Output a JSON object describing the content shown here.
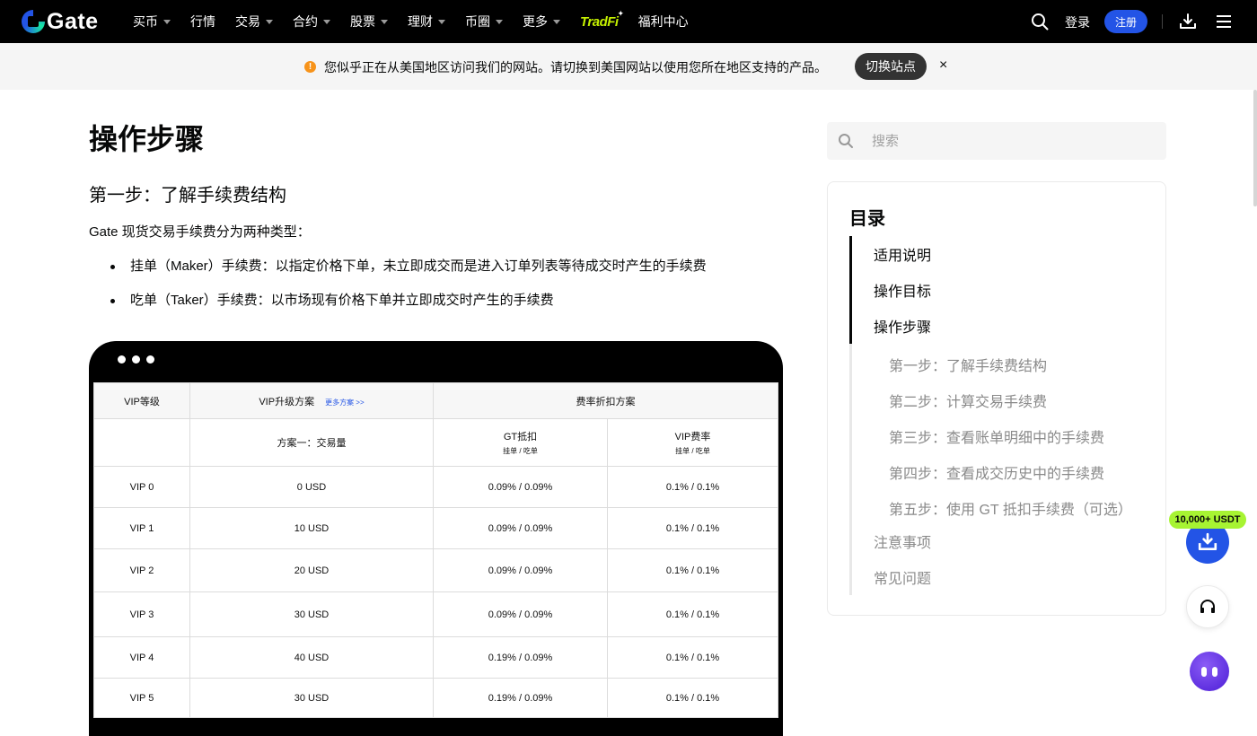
{
  "nav": {
    "logo_text": "Gate",
    "items": [
      {
        "label": "买币",
        "caret": true
      },
      {
        "label": "行情",
        "caret": false
      },
      {
        "label": "交易",
        "caret": true
      },
      {
        "label": "合约",
        "caret": true
      },
      {
        "label": "股票",
        "caret": true
      },
      {
        "label": "理财",
        "caret": true
      },
      {
        "label": "币圈",
        "caret": true
      },
      {
        "label": "更多",
        "caret": true
      }
    ],
    "tradfi": "TradFi",
    "welfare": "福利中心",
    "login": "登录",
    "register": "注册"
  },
  "notice": {
    "text": "您似乎正在从美国地区访问我们的网站。请切换到美国网站以使用您所在地区支持的产品。",
    "switch_label": "切换站点",
    "close": "×"
  },
  "article": {
    "h1": "操作步骤",
    "h2": "第一步：了解手续费结构",
    "intro": "Gate 现货交易手续费分为两种类型：",
    "bullets": [
      "挂单（Maker）手续费：以指定价格下单，未立即成交而是进入订单列表等待成交时产生的手续费",
      "吃单（Taker）手续费：以市场现有价格下单并立即成交时产生的手续费"
    ]
  },
  "fee_table": {
    "col_vip": "VIP等级",
    "col_upgrade": "VIP升级方案",
    "more_plans": "更多方案 >>",
    "col_discount": "费率折扣方案",
    "plan1": "方案一：交易量",
    "gt_deduct": "GT抵扣",
    "vip_rate": "VIP费率",
    "maker_taker": "挂单 / 吃单",
    "rows": [
      {
        "level": "VIP 0",
        "volume": "0 USD",
        "gt": "0.09% / 0.09%",
        "vip": "0.1% / 0.1%"
      },
      {
        "level": "VIP 1",
        "volume": "10 USD",
        "gt": "0.09% / 0.09%",
        "vip": "0.1% / 0.1%"
      },
      {
        "level": "VIP 2",
        "volume": "20 USD",
        "gt": "0.09% / 0.09%",
        "vip": "0.1% / 0.1%"
      },
      {
        "level": "VIP 3",
        "volume": "30 USD",
        "gt": "0.09% / 0.09%",
        "vip": "0.1% / 0.1%"
      },
      {
        "level": "VIP 4",
        "volume": "40 USD",
        "gt": "0.19% / 0.09%",
        "vip": "0.1% / 0.1%"
      },
      {
        "level": "VIP 5",
        "volume": "30 USD",
        "gt": "0.19% / 0.09%",
        "vip": "0.1% / 0.1%"
      }
    ]
  },
  "sidebar": {
    "search_placeholder": "搜索",
    "toc_title": "目录",
    "toc": [
      {
        "label": "适用说明",
        "kind": "active"
      },
      {
        "label": "操作目标",
        "kind": "active"
      },
      {
        "label": "操作步骤",
        "kind": "active"
      },
      {
        "label": "第一步：了解手续费结构",
        "kind": "sub"
      },
      {
        "label": "第二步：计算交易手续费",
        "kind": "sub"
      },
      {
        "label": "第三步：查看账单明细中的手续费",
        "kind": "sub"
      },
      {
        "label": "第四步：查看成交历史中的手续费",
        "kind": "sub"
      },
      {
        "label": "第五步：使用 GT 抵扣手续费（可选）",
        "kind": "sub"
      },
      {
        "label": "注意事项",
        "kind": "dim"
      },
      {
        "label": "常见问题",
        "kind": "dim"
      }
    ]
  },
  "floating": {
    "badge": "10,000+ USDT"
  },
  "colors": {
    "brand_blue": "#2354e6",
    "badge_green": "#a7f432",
    "tradfi": "#c4f000"
  }
}
